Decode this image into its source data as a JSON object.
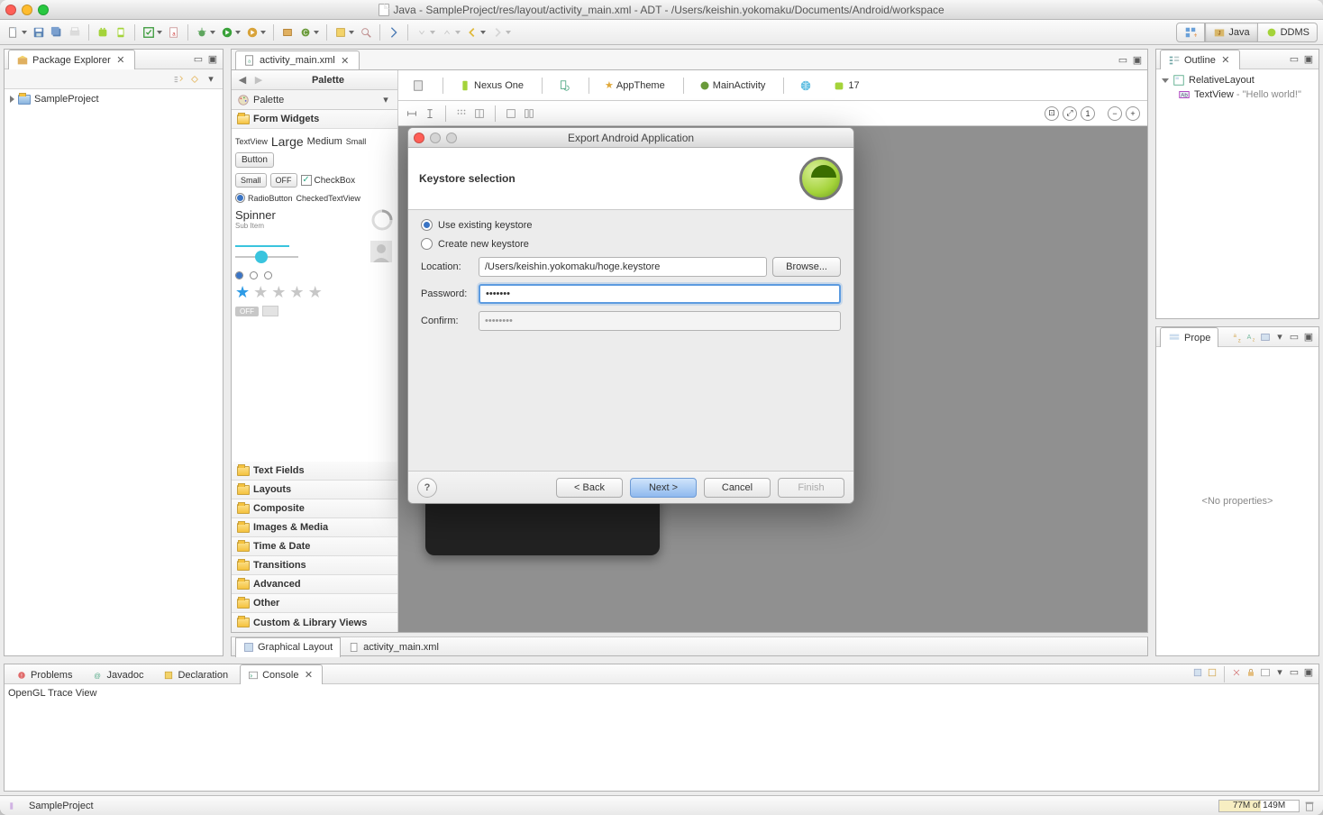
{
  "window": {
    "title": "Java - SampleProject/res/layout/activity_main.xml - ADT - /Users/keishin.yokomaku/Documents/Android/workspace"
  },
  "perspectives": {
    "java": "Java",
    "ddms": "DDMS"
  },
  "pkg_explorer": {
    "title": "Package Explorer",
    "items": [
      "SampleProject"
    ]
  },
  "editor": {
    "tab": "activity_main.xml",
    "palette": {
      "title": "Palette",
      "cats": [
        "Form Widgets",
        "Text Fields",
        "Layouts",
        "Composite",
        "Images & Media",
        "Time & Date",
        "Transitions",
        "Advanced",
        "Other",
        "Custom & Library Views"
      ],
      "widgets": {
        "textview": "TextView",
        "large": "Large",
        "medium": "Medium",
        "small": "Small",
        "button": "Button",
        "small2": "Small",
        "off": "OFF",
        "checkbox": "CheckBox",
        "radiobutton": "RadioButton",
        "checkedtextview": "CheckedTextView",
        "spinner": "Spinner",
        "subitem": "Sub Item",
        "toggle_off": "OFF"
      }
    },
    "canvas_toolbar": {
      "device": "Nexus One",
      "theme": "AppTheme",
      "activity": "MainActivity",
      "api": "17"
    },
    "bottom_tabs": {
      "graphical": "Graphical Layout",
      "xml": "activity_main.xml"
    }
  },
  "outline": {
    "title": "Outline",
    "root": "RelativeLayout",
    "child": "TextView",
    "child_val": " - \"Hello world!\""
  },
  "props": {
    "title": "Prope",
    "empty": "<No properties>"
  },
  "bottom": {
    "tabs": [
      "Problems",
      "Javadoc",
      "Declaration",
      "Console"
    ],
    "body": "OpenGL Trace View"
  },
  "status": {
    "project": "SampleProject",
    "heap": "77M of 149M"
  },
  "dialog": {
    "title": "Export Android Application",
    "banner": "Keystore selection",
    "use_existing": "Use existing keystore",
    "create_new": "Create new keystore",
    "location_lbl": "Location:",
    "location_val": "/Users/keishin.yokomaku/hoge.keystore",
    "browse": "Browse...",
    "password_lbl": "Password:",
    "password_val": "•••••••",
    "confirm_lbl": "Confirm:",
    "confirm_val": "••••••••",
    "back": "< Back",
    "next": "Next >",
    "cancel": "Cancel",
    "finish": "Finish"
  }
}
